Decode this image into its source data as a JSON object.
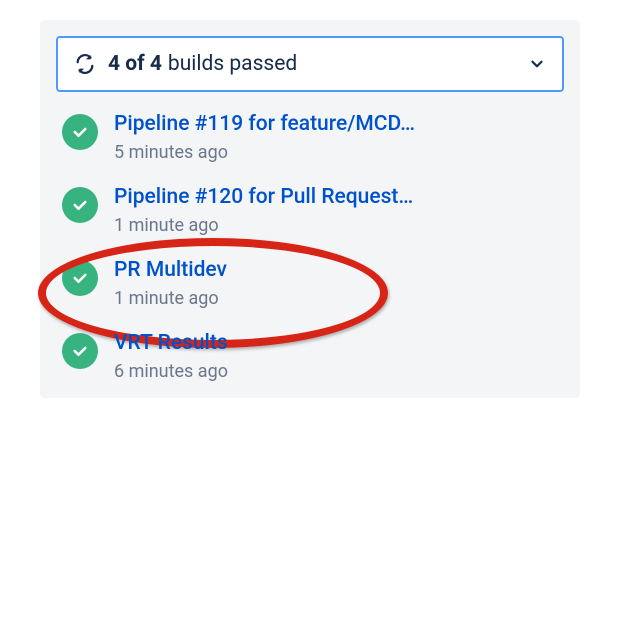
{
  "summary": {
    "count_text": "4 of 4",
    "rest_text": "builds passed"
  },
  "builds": [
    {
      "title": "Pipeline #119 for feature/MCD…",
      "time": "5 minutes ago"
    },
    {
      "title": "Pipeline #120 for Pull Request…",
      "time": "1 minute ago"
    },
    {
      "title": "PR Multidev",
      "time": "1 minute ago"
    },
    {
      "title": "VRT Results",
      "time": "6 minutes ago"
    }
  ],
  "highlight_index": 2
}
